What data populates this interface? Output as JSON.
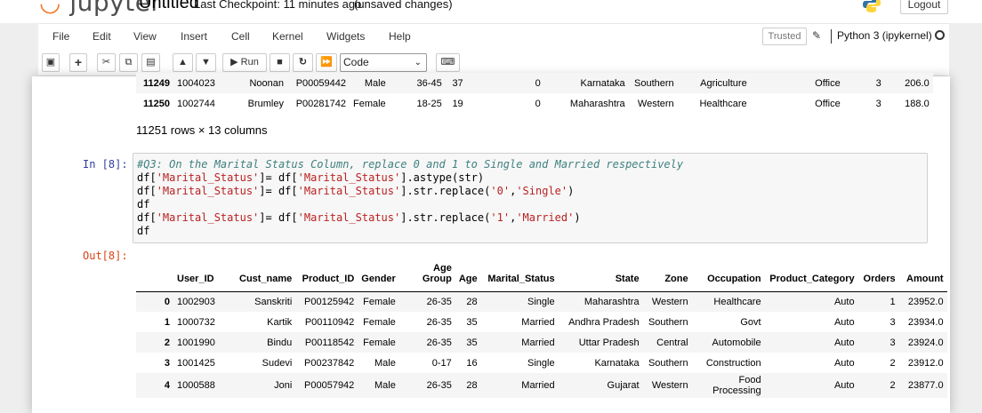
{
  "header": {
    "logo": "jupyter",
    "notebook_name": "Untitled",
    "checkpoint": "Last Checkpoint: 11 minutes ago",
    "autosave": "(unsaved changes)",
    "logout_label": "Logout"
  },
  "menu": [
    "File",
    "Edit",
    "View",
    "Insert",
    "Cell",
    "Kernel",
    "Widgets",
    "Help"
  ],
  "kernel": {
    "trusted_label": "Trusted",
    "name": "Python 3 (ipykernel)"
  },
  "toolbar": {
    "run_label": "Run",
    "cell_type": "Code"
  },
  "top_table": {
    "rows": [
      [
        "11249",
        "1004023",
        "Noonan",
        "P00059442",
        "Male",
        "36-45",
        "37",
        "0",
        "Karnataka",
        "Southern",
        "Agriculture",
        "Office",
        "3",
        "206.0"
      ],
      [
        "11250",
        "1002744",
        "Brumley",
        "P00281742",
        "Female",
        "18-25",
        "19",
        "0",
        "Maharashtra",
        "Western",
        "Healthcare",
        "Office",
        "3",
        "188.0"
      ]
    ]
  },
  "rows_info": "11251 rows × 13 columns",
  "cell": {
    "in_prompt": "In [8]:",
    "out_prompt": "Out[8]:",
    "comment": "#Q3: On the Marital Status Column, replace 0 and 1 to Single and Married respectively"
  },
  "output_table": {
    "headers": [
      "",
      "User_ID",
      "Cust_name",
      "Product_ID",
      "Gender",
      "Age Group",
      "Age",
      "Marital_Status",
      "State",
      "Zone",
      "Occupation",
      "Product_Category",
      "Orders",
      "Amount"
    ],
    "rows": [
      [
        "0",
        "1002903",
        "Sanskriti",
        "P00125942",
        "Female",
        "26-35",
        "28",
        "Single",
        "Maharashtra",
        "Western",
        "Healthcare",
        "Auto",
        "1",
        "23952.0"
      ],
      [
        "1",
        "1000732",
        "Kartik",
        "P00110942",
        "Female",
        "26-35",
        "35",
        "Married",
        "Andhra Pradesh",
        "Southern",
        "Govt",
        "Auto",
        "3",
        "23934.0"
      ],
      [
        "2",
        "1001990",
        "Bindu",
        "P00118542",
        "Female",
        "26-35",
        "35",
        "Married",
        "Uttar Pradesh",
        "Central",
        "Automobile",
        "Auto",
        "3",
        "23924.0"
      ],
      [
        "3",
        "1001425",
        "Sudevi",
        "P00237842",
        "Male",
        "0-17",
        "16",
        "Single",
        "Karnataka",
        "Southern",
        "Construction",
        "Auto",
        "2",
        "23912.0"
      ],
      [
        "4",
        "1000588",
        "Joni",
        "P00057942",
        "Male",
        "26-35",
        "28",
        "Married",
        "Gujarat",
        "Western",
        "Food Processing",
        "Auto",
        "2",
        "23877.0"
      ]
    ]
  }
}
